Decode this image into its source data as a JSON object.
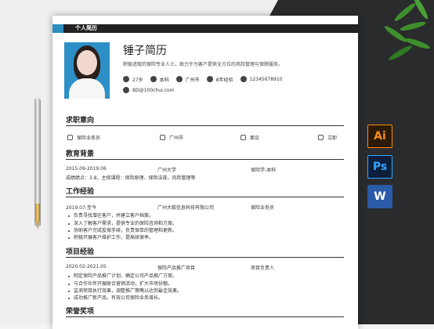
{
  "header": {
    "label": "个人简历"
  },
  "profile": {
    "name": "锤子简历",
    "intro": "积极进取的保险专业人士，致力于为客户提供全方位的风险管理与保障服务。",
    "info": [
      "27岁",
      "本科",
      "广州市",
      "8年经验",
      "12345678910"
    ],
    "email": "BD@100chui.com"
  },
  "sections": {
    "intent": {
      "title": "求职意向",
      "items": [
        "保险业务员",
        "广州市",
        "面议",
        "立即"
      ]
    },
    "education": {
      "title": "教育背景",
      "date": "2015.09-2019.06",
      "school": "广州大学",
      "major": "保险学-本科",
      "detail": "成绩绩点：3.8，主修课程：保险原理、保险法规、风险管理等"
    },
    "work": {
      "title": "工作经验",
      "date": "2019.07-至今",
      "company": "广州大毅信息科技有限公司",
      "position": "保险业务员",
      "bullets": [
        "负责寻找潜在客户，并建立客户档案。",
        "深入了解客户需求，提供专业的保险咨询和方案。",
        "协助客户完成投保手续，负责保单的管理和更新。",
        "积极开展客户维护工作，提高续保率。"
      ]
    },
    "project": {
      "title": "项目经验",
      "date": "2020.02-2021.05",
      "name": "保险产品推广项目",
      "role": "项目负责人",
      "bullets": [
        "制定保险产品推广计划，确定公司产品推广方案。",
        "与合作伙伴开展联合营销活动，扩大市场份额。",
        "监测项目执行效果，调整推广策略以达到最佳效果。",
        "成功推广新产品，有效公司保险业务增长。"
      ]
    },
    "honors": {
      "title": "荣誉奖项"
    }
  },
  "apps": {
    "ai": "Ai",
    "ps": "Ps",
    "word": "W"
  },
  "colors": {
    "accent": "#2e8fc0",
    "dark": "#222222"
  }
}
